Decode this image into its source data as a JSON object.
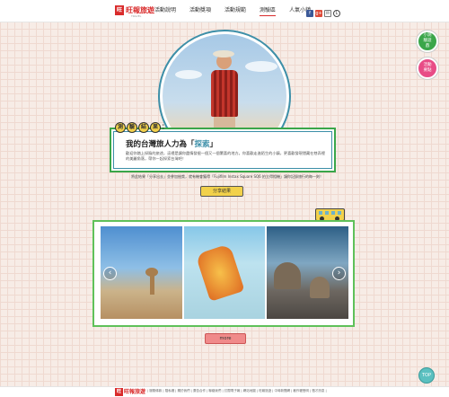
{
  "header": {
    "logo_box": "旺",
    "logo_text": "旺報旅遊",
    "logo_sub": "TRAVEL",
    "nav": [
      "活動說明",
      "活動獎項",
      "活動規範",
      "測驗區",
      "人氣小鎮"
    ],
    "social": {
      "fb": "f",
      "g": "g+",
      "mail": "✉",
      "line": "L"
    }
  },
  "side": {
    "green": "小測驗遊戲",
    "pink": "活動要點"
  },
  "result": {
    "tag": [
      "測",
      "驗",
      "結",
      "果"
    ],
    "tag_colon": "：",
    "title_prefix": "我的台灣旅人力為「",
    "title_highlight": "探索",
    "title_suffix": "」",
    "desc": "歡迎你踏上探險的旅途，這裡是讓你盡情發掘一個又一個驚喜的地方。你喜歡走進陌生的小鎮，更喜歡發現隱藏在巷弄裡的美麗角落，帶你一起探索台灣吧！"
  },
  "share": {
    "note": "將此結果「分享出去」並參加抽獎，就有機會獲得「Fujifilm Instax Square SQ6 拍立得相機」讓你記錄旅行的每一刻！",
    "button": "分享結果"
  },
  "gallery": {
    "prev": "‹",
    "next": "›",
    "more": "more"
  },
  "top_button": "TOP",
  "footer": {
    "links": "| 服務條款 | 隱私權 | 關於我們 | 廣告合作 | 聯絡我們 | 訂閱電子報 | 網站地圖 | 旺報旅遊 | 中時新聞網 | 著作權聲明 | 徵才訊息 |"
  }
}
